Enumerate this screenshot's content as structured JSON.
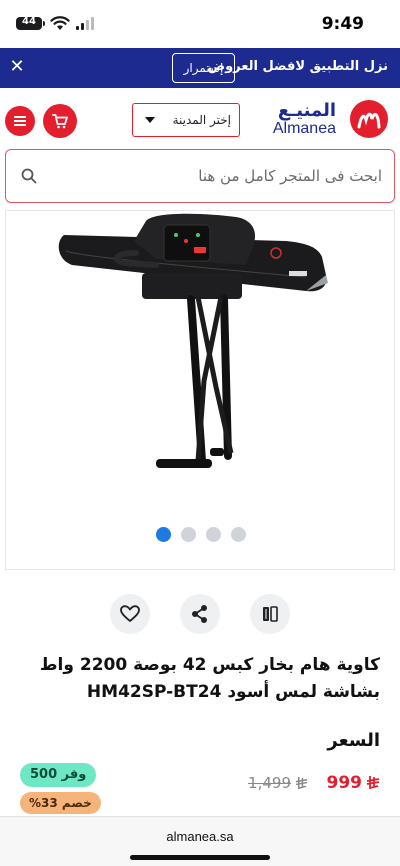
{
  "status_bar": {
    "time": "9:49",
    "battery": "44"
  },
  "promo": {
    "text": "نزل التطبيق لافضل العروض",
    "button_label": "إستمرار"
  },
  "header": {
    "logo_arabic": "المنيـع",
    "logo_english": "Almanea",
    "city_select_label": "إختر المدينة"
  },
  "search": {
    "placeholder": "ابحث فى المتجر كامل من هنا"
  },
  "gallery": {
    "slide_count": 4,
    "active_index": 0
  },
  "product": {
    "title": "كاوية هام بخار كبس 42 بوصة 2200 واط بشاشة لمس أسود HM42SP-BT24",
    "price_label": "السعر",
    "price_current": "999",
    "price_old": "1,499",
    "save_label": "وفر 500",
    "discount_label": "خصم 33%"
  },
  "browser": {
    "url": "almanea.sa"
  },
  "colors": {
    "brand_red": "#e31e2d",
    "brand_navy": "#1d2a8f",
    "save_green": "#6ee7c5",
    "discount_orange": "#f7b47a"
  }
}
